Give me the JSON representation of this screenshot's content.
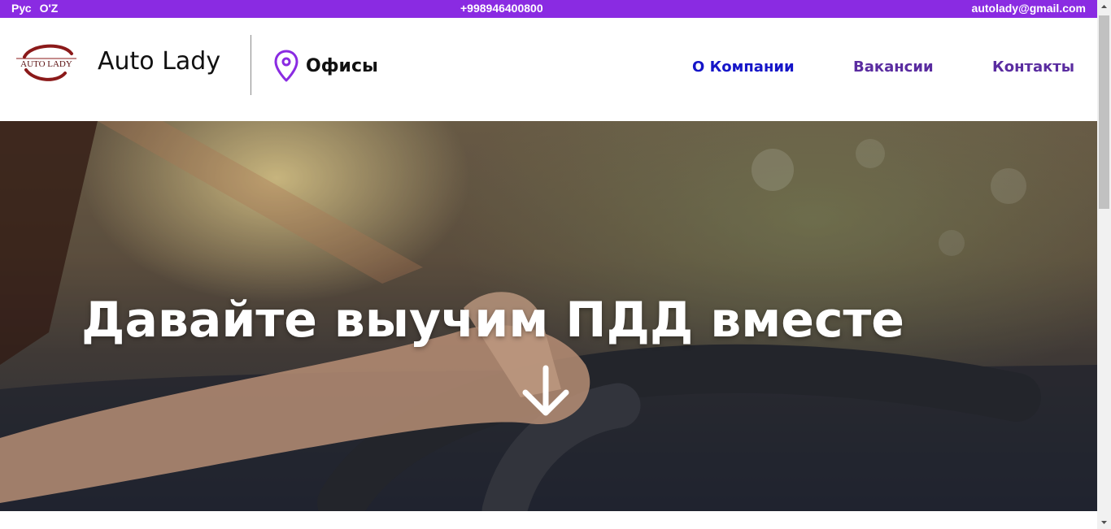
{
  "topbar": {
    "lang_ru": "Рус",
    "lang_uz": "O'Z",
    "phone": "+998946400800",
    "email": "autolady@gmail.com"
  },
  "header": {
    "logo_text": "AUTO LADY",
    "brand": "Auto Lady",
    "offices_label": "Офисы",
    "nav": {
      "about": "О Компании",
      "jobs": "Вакансии",
      "contacts": "Контакты"
    }
  },
  "hero": {
    "headline": "Давайте выучим ПДД вместе"
  },
  "colors": {
    "accent": "#8a2be2",
    "nav_primary": "#1515c8",
    "nav_secondary": "#5a2ca0",
    "logo_red": "#8b1a1a"
  },
  "icons": {
    "offices": "map-pin-icon",
    "scroll_hint": "arrow-down-icon"
  }
}
